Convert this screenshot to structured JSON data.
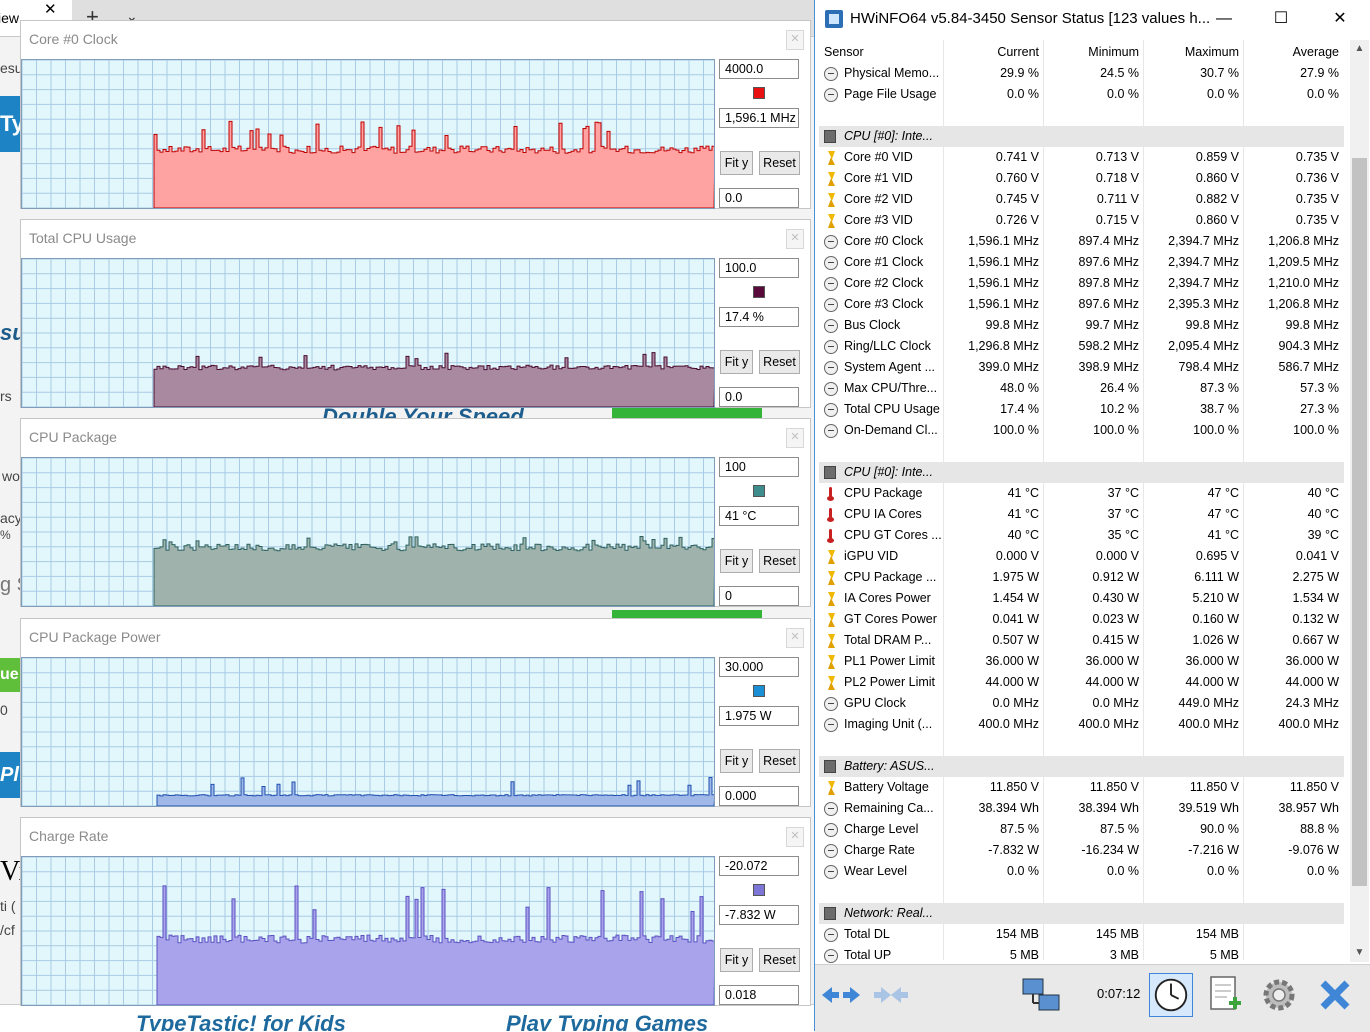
{
  "browser": {
    "tab_label": "iew",
    "tab_close": "✕",
    "new_tab": "+",
    "tab_menu": "⌄",
    "fragments": [
      "esul",
      "Ty",
      "su",
      "rs",
      "wo",
      "acy",
      "%",
      "g S",
      "ue",
      "0",
      "Pl",
      "Vi",
      "ti (",
      "/cf"
    ],
    "ad_text": "Double Your Speed",
    "bottom_links": [
      "TypeTastic! for Kids",
      "Play Typing Games"
    ]
  },
  "graphs": [
    {
      "title": "Core #0 Clock",
      "max": "4000.0",
      "current": "1,596.1 MHz",
      "min": "0.0",
      "color": "#e81010",
      "fill": "#ffa2a2",
      "line": "#c00000",
      "ymax": 4000,
      "baseline": 1596,
      "spike": 2395
    },
    {
      "title": "Total CPU Usage",
      "max": "100.0",
      "current": "17.4 %",
      "min": "0.0",
      "color": "#5a0a3a",
      "fill": "#a8899f",
      "line": "#4a0a30",
      "ymax": 100,
      "baseline": 27,
      "spike": 38
    },
    {
      "title": "CPU Package",
      "max": "100",
      "current": "41 °C",
      "min": "0",
      "color": "#3e8c8c",
      "fill": "#9fb3ac",
      "line": "#2c6060",
      "ymax": 100,
      "baseline": 40,
      "spike": 47
    },
    {
      "title": "CPU Package Power",
      "max": "30.000",
      "current": "1.975 W",
      "min": "0.000",
      "color": "#1a8fd6",
      "fill": "#9fb8e8",
      "line": "#2050b0",
      "ymax": 30,
      "baseline": 2.2,
      "spike": 6.1
    },
    {
      "title": "Charge Rate",
      "max": "-20.072",
      "current": "-7.832 W",
      "min": "0.018",
      "color": "#7e76d6",
      "fill": "#a9a3ec",
      "line": "#5a52c0",
      "ymax": 20,
      "baseline": 9,
      "spike": 16.2
    }
  ],
  "graph_buttons": {
    "fit": "Fit y",
    "reset": "Reset",
    "close": "✕"
  },
  "hwinfo": {
    "title": "HWiNFO64 v5.84-3450 Sensor Status [123 values h...",
    "controls": {
      "minimize": "—",
      "maximize": "☐",
      "close": "✕"
    },
    "columns": [
      "Sensor",
      "Current",
      "Minimum",
      "Maximum",
      "Average"
    ],
    "rows": [
      {
        "t": "row",
        "icon": "clock",
        "name": "Physical Memo...",
        "v": [
          "29.9 %",
          "24.5 %",
          "30.7 %",
          "27.9 %"
        ]
      },
      {
        "t": "row",
        "icon": "clock",
        "name": "Page File Usage",
        "v": [
          "0.0 %",
          "0.0 %",
          "0.0 %",
          "0.0 %"
        ]
      },
      {
        "t": "blank"
      },
      {
        "t": "group",
        "name": "CPU [#0]: Inte..."
      },
      {
        "t": "row",
        "icon": "bolt",
        "name": "Core #0 VID",
        "v": [
          "0.741 V",
          "0.713 V",
          "0.859 V",
          "0.735 V"
        ]
      },
      {
        "t": "row",
        "icon": "bolt",
        "name": "Core #1 VID",
        "v": [
          "0.760 V",
          "0.718 V",
          "0.860 V",
          "0.736 V"
        ]
      },
      {
        "t": "row",
        "icon": "bolt",
        "name": "Core #2 VID",
        "v": [
          "0.745 V",
          "0.711 V",
          "0.882 V",
          "0.735 V"
        ]
      },
      {
        "t": "row",
        "icon": "bolt",
        "name": "Core #3 VID",
        "v": [
          "0.726 V",
          "0.715 V",
          "0.860 V",
          "0.735 V"
        ]
      },
      {
        "t": "row",
        "icon": "clock",
        "name": "Core #0 Clock",
        "v": [
          "1,596.1 MHz",
          "897.4 MHz",
          "2,394.7 MHz",
          "1,206.8 MHz"
        ]
      },
      {
        "t": "row",
        "icon": "clock",
        "name": "Core #1 Clock",
        "v": [
          "1,596.1 MHz",
          "897.6 MHz",
          "2,394.7 MHz",
          "1,209.5 MHz"
        ]
      },
      {
        "t": "row",
        "icon": "clock",
        "name": "Core #2 Clock",
        "v": [
          "1,596.1 MHz",
          "897.8 MHz",
          "2,394.7 MHz",
          "1,210.0 MHz"
        ]
      },
      {
        "t": "row",
        "icon": "clock",
        "name": "Core #3 Clock",
        "v": [
          "1,596.1 MHz",
          "897.6 MHz",
          "2,395.3 MHz",
          "1,206.8 MHz"
        ]
      },
      {
        "t": "row",
        "icon": "clock",
        "name": "Bus Clock",
        "v": [
          "99.8 MHz",
          "99.7 MHz",
          "99.8 MHz",
          "99.8 MHz"
        ]
      },
      {
        "t": "row",
        "icon": "clock",
        "name": "Ring/LLC Clock",
        "v": [
          "1,296.8 MHz",
          "598.2 MHz",
          "2,095.4 MHz",
          "904.3 MHz"
        ]
      },
      {
        "t": "row",
        "icon": "clock",
        "name": "System Agent ...",
        "v": [
          "399.0 MHz",
          "398.9 MHz",
          "798.4 MHz",
          "586.7 MHz"
        ]
      },
      {
        "t": "row",
        "icon": "clock",
        "name": "Max CPU/Thre...",
        "v": [
          "48.0 %",
          "26.4 %",
          "87.3 %",
          "57.3 %"
        ]
      },
      {
        "t": "row",
        "icon": "clock",
        "name": "Total CPU Usage",
        "v": [
          "17.4 %",
          "10.2 %",
          "38.7 %",
          "27.3 %"
        ]
      },
      {
        "t": "row",
        "icon": "clock",
        "name": "On-Demand Cl...",
        "v": [
          "100.0 %",
          "100.0 %",
          "100.0 %",
          "100.0 %"
        ]
      },
      {
        "t": "blank"
      },
      {
        "t": "group",
        "name": "CPU [#0]: Inte..."
      },
      {
        "t": "row",
        "icon": "therm",
        "name": "CPU Package",
        "v": [
          "41 °C",
          "37 °C",
          "47 °C",
          "40 °C"
        ]
      },
      {
        "t": "row",
        "icon": "therm",
        "name": "CPU IA Cores",
        "v": [
          "41 °C",
          "37 °C",
          "47 °C",
          "40 °C"
        ]
      },
      {
        "t": "row",
        "icon": "therm",
        "name": "CPU GT Cores ...",
        "v": [
          "40 °C",
          "35 °C",
          "41 °C",
          "39 °C"
        ]
      },
      {
        "t": "row",
        "icon": "bolt",
        "name": "iGPU VID",
        "v": [
          "0.000 V",
          "0.000 V",
          "0.695 V",
          "0.041 V"
        ]
      },
      {
        "t": "row",
        "icon": "bolt",
        "name": "CPU Package ...",
        "v": [
          "1.975 W",
          "0.912 W",
          "6.111 W",
          "2.275 W"
        ]
      },
      {
        "t": "row",
        "icon": "bolt",
        "name": "IA Cores Power",
        "v": [
          "1.454 W",
          "0.430 W",
          "5.210 W",
          "1.534 W"
        ]
      },
      {
        "t": "row",
        "icon": "bolt",
        "name": "GT Cores Power",
        "v": [
          "0.041 W",
          "0.023 W",
          "0.160 W",
          "0.132 W"
        ]
      },
      {
        "t": "row",
        "icon": "bolt",
        "name": "Total DRAM P...",
        "v": [
          "0.507 W",
          "0.415 W",
          "1.026 W",
          "0.667 W"
        ]
      },
      {
        "t": "row",
        "icon": "bolt",
        "name": "PL1 Power Limit",
        "v": [
          "36.000 W",
          "36.000 W",
          "36.000 W",
          "36.000 W"
        ]
      },
      {
        "t": "row",
        "icon": "bolt",
        "name": "PL2 Power Limit",
        "v": [
          "44.000 W",
          "44.000 W",
          "44.000 W",
          "44.000 W"
        ]
      },
      {
        "t": "row",
        "icon": "clock",
        "name": "GPU Clock",
        "v": [
          "0.0 MHz",
          "0.0 MHz",
          "449.0 MHz",
          "24.3 MHz"
        ]
      },
      {
        "t": "row",
        "icon": "clock",
        "name": "Imaging Unit (...",
        "v": [
          "400.0 MHz",
          "400.0 MHz",
          "400.0 MHz",
          "400.0 MHz"
        ]
      },
      {
        "t": "blank"
      },
      {
        "t": "group",
        "name": "Battery: ASUS..."
      },
      {
        "t": "row",
        "icon": "bolt",
        "name": "Battery Voltage",
        "v": [
          "11.850 V",
          "11.850 V",
          "11.850 V",
          "11.850 V"
        ]
      },
      {
        "t": "row",
        "icon": "clock",
        "name": "Remaining Ca...",
        "v": [
          "38.394 Wh",
          "38.394 Wh",
          "39.519 Wh",
          "38.957 Wh"
        ]
      },
      {
        "t": "row",
        "icon": "clock",
        "name": "Charge Level",
        "v": [
          "87.5 %",
          "87.5 %",
          "90.0 %",
          "88.8 %"
        ]
      },
      {
        "t": "row",
        "icon": "clock",
        "name": "Charge Rate",
        "v": [
          "-7.832 W",
          "-16.234 W",
          "-7.216 W",
          "-9.076 W"
        ]
      },
      {
        "t": "row",
        "icon": "clock",
        "name": "Wear Level",
        "v": [
          "0.0 %",
          "0.0 %",
          "0.0 %",
          "0.0 %"
        ]
      },
      {
        "t": "blank"
      },
      {
        "t": "group",
        "name": "Network: Real..."
      },
      {
        "t": "row",
        "icon": "clock",
        "name": "Total DL",
        "v": [
          "154 MB",
          "145 MB",
          "154 MB",
          ""
        ]
      },
      {
        "t": "row",
        "icon": "clock",
        "name": "Total UP",
        "v": [
          "5 MB",
          "3 MB",
          "5 MB",
          ""
        ]
      }
    ],
    "toolbar": {
      "elapsed_time": "0:07:12"
    },
    "scroll": {
      "up": "▲",
      "down": "▼"
    }
  },
  "colors": {
    "accent": "#1d83c4",
    "grid": "#a9cbe6",
    "plot_bg": "#e1f7fb"
  }
}
